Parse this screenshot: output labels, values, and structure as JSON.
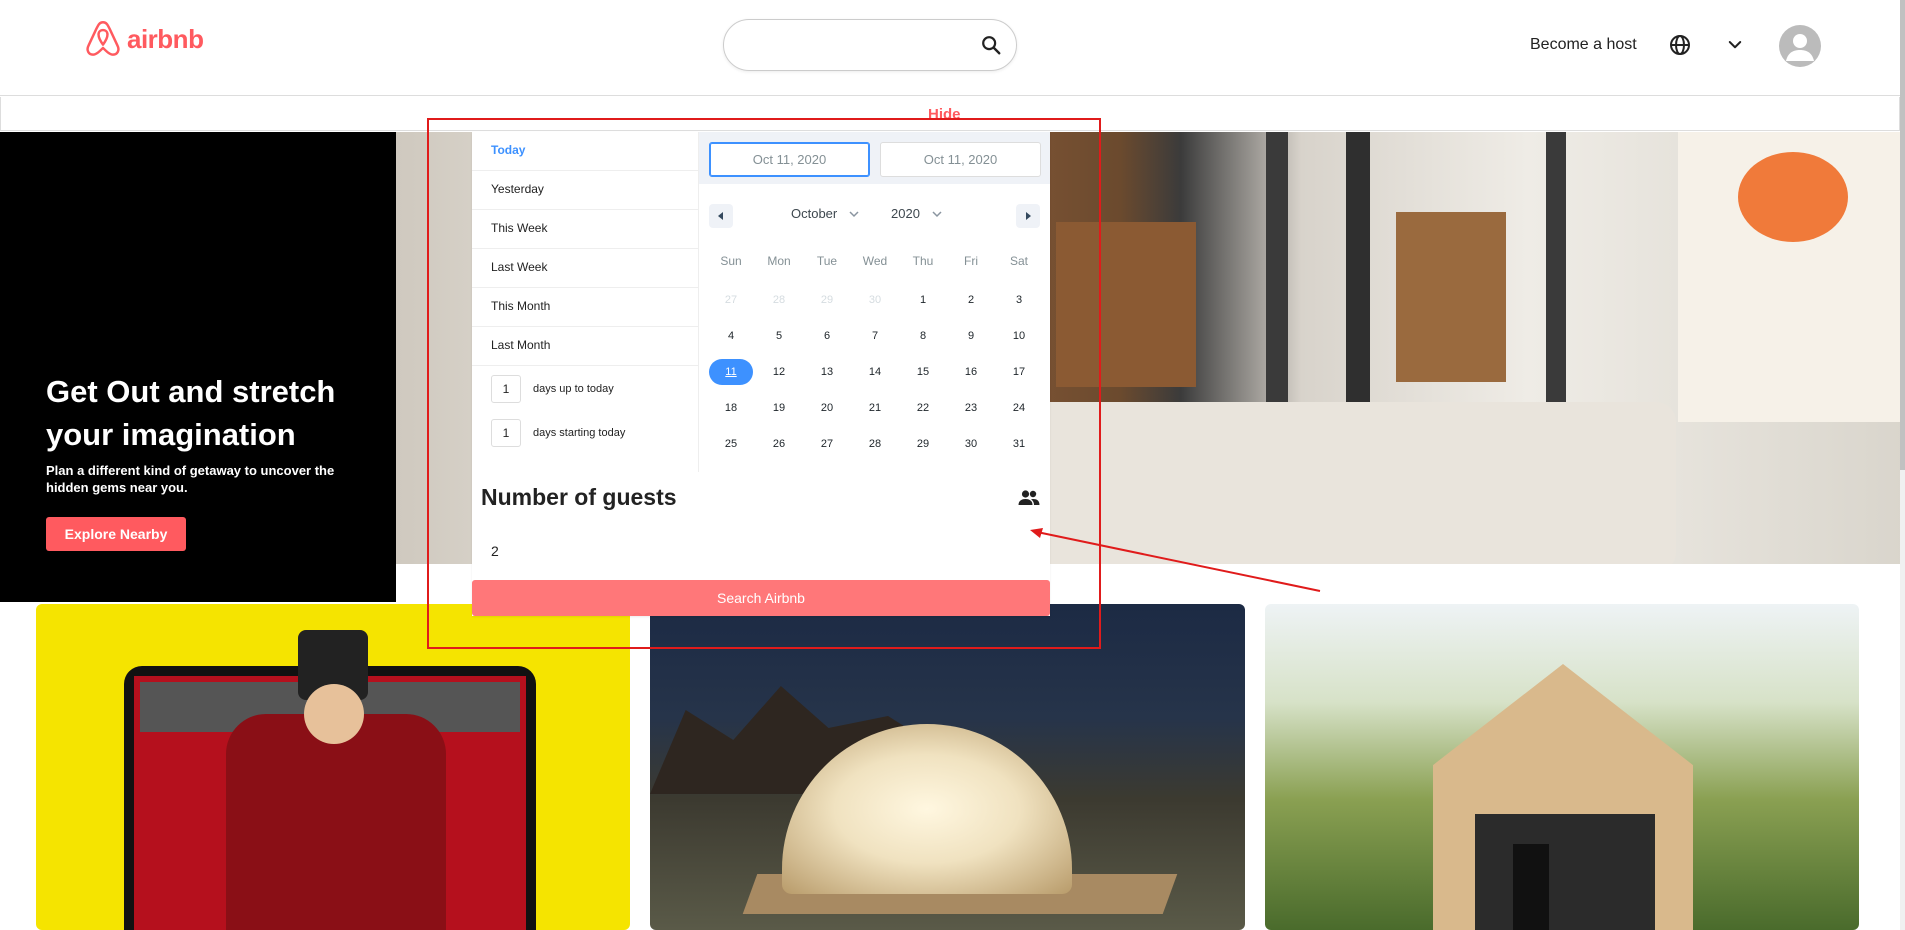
{
  "brand": {
    "name": "airbnb",
    "color": "#FF5A5F"
  },
  "header": {
    "search_placeholder": "",
    "host_link": "Become a host",
    "hide_label": "Hide"
  },
  "hero": {
    "title": "Get Out and stretch your imagination",
    "subtitle": "Plan a different kind of getaway to uncover the hidden gems near you.",
    "button": "Explore Nearby"
  },
  "date_picker": {
    "static_ranges": [
      "Today",
      "Yesterday",
      "This Week",
      "Last Week",
      "This Month",
      "Last Month"
    ],
    "active_range": "Today",
    "input_ranges": [
      {
        "value": "1",
        "label": "days up to today"
      },
      {
        "value": "1",
        "label": "days starting today"
      }
    ],
    "start_date": "Oct 11, 2020",
    "end_date": "Oct 11, 2020",
    "month": "October",
    "year": "2020",
    "weekdays": [
      "Sun",
      "Mon",
      "Tue",
      "Wed",
      "Thu",
      "Fri",
      "Sat"
    ],
    "days": [
      {
        "d": "27",
        "passive": true
      },
      {
        "d": "28",
        "passive": true
      },
      {
        "d": "29",
        "passive": true
      },
      {
        "d": "30",
        "passive": true
      },
      {
        "d": "1"
      },
      {
        "d": "2"
      },
      {
        "d": "3"
      },
      {
        "d": "4"
      },
      {
        "d": "5"
      },
      {
        "d": "6"
      },
      {
        "d": "7"
      },
      {
        "d": "8"
      },
      {
        "d": "9"
      },
      {
        "d": "10"
      },
      {
        "d": "11",
        "today": true
      },
      {
        "d": "12"
      },
      {
        "d": "13"
      },
      {
        "d": "14"
      },
      {
        "d": "15"
      },
      {
        "d": "16"
      },
      {
        "d": "17"
      },
      {
        "d": "18"
      },
      {
        "d": "19"
      },
      {
        "d": "20"
      },
      {
        "d": "21"
      },
      {
        "d": "22"
      },
      {
        "d": "23"
      },
      {
        "d": "24"
      },
      {
        "d": "25"
      },
      {
        "d": "26"
      },
      {
        "d": "27"
      },
      {
        "d": "28"
      },
      {
        "d": "29"
      },
      {
        "d": "30"
      },
      {
        "d": "31"
      }
    ],
    "accent_color": "#3d91ff"
  },
  "guests": {
    "title": "Number of guests",
    "value": "2",
    "icon": "people-icon"
  },
  "search_button": "Search Airbnb",
  "annotation_color": "#e01b1b"
}
